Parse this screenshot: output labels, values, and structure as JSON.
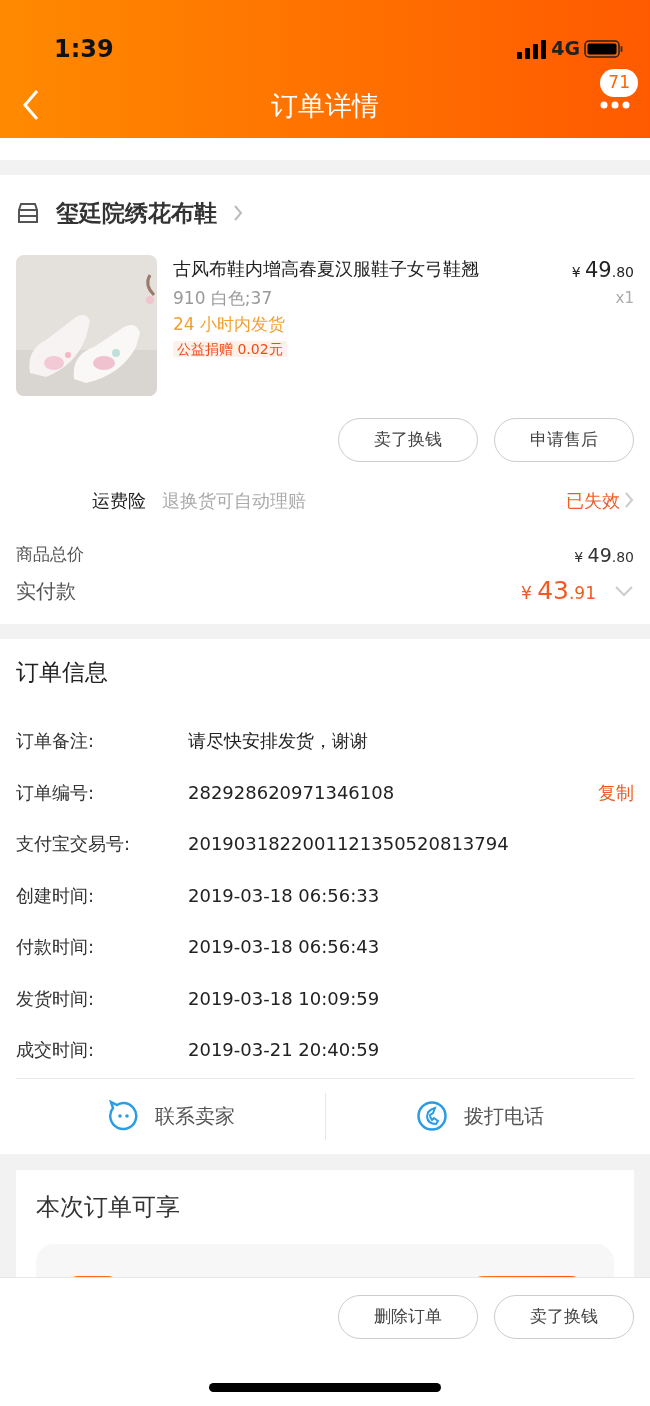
{
  "status_bar": {
    "time": "1:39",
    "network": "4G"
  },
  "nav": {
    "title": "订单详情",
    "badge": "71"
  },
  "store": {
    "name": "玺廷院绣花布鞋"
  },
  "product": {
    "title": "古风布鞋内增高春夏汉服鞋子女弓鞋翘",
    "sku": "910 白色;37",
    "shipping_note": "24 小时内发货",
    "charity_tag": "公益捐赠 0.02元",
    "price": {
      "currency": "¥",
      "integer": "49",
      "decimal": ".80"
    },
    "quantity": "x1"
  },
  "item_actions": [
    "卖了换钱",
    "申请售后"
  ],
  "insurance": {
    "label": "运费险",
    "description": "退换货可自动理赔",
    "status": "已失效"
  },
  "totals": [
    {
      "kind": "subtotal",
      "label": "商品总价",
      "currency": "¥",
      "integer": "49",
      "decimal": ".80"
    },
    {
      "kind": "paid",
      "label": "实付款",
      "currency": "¥",
      "integer": "43",
      "decimal": ".91",
      "expanded": false
    }
  ],
  "order_info": {
    "title": "订单信息",
    "rows": [
      {
        "label": "订单备注:",
        "value": "请尽快安排发货，谢谢"
      },
      {
        "label": "订单编号:",
        "value": "282928620971346108",
        "action": "复制"
      },
      {
        "label": "支付宝交易号:",
        "value": "2019031822001121350520813794"
      },
      {
        "label": "创建时间:",
        "value": "2019-03-18 06:56:33"
      },
      {
        "label": "付款时间:",
        "value": "2019-03-18 06:56:43"
      },
      {
        "label": "发货时间:",
        "value": "2019-03-18 10:09:59"
      },
      {
        "label": "成交时间:",
        "value": "2019-03-21 20:40:59"
      }
    ]
  },
  "contact_actions": [
    {
      "kind": "chat",
      "label": "联系卖家"
    },
    {
      "kind": "phone",
      "label": "拨打电话"
    }
  ],
  "benefits": {
    "title": "本次订单可享"
  },
  "bottom_actions": [
    "删除订单",
    "卖了换钱"
  ]
}
